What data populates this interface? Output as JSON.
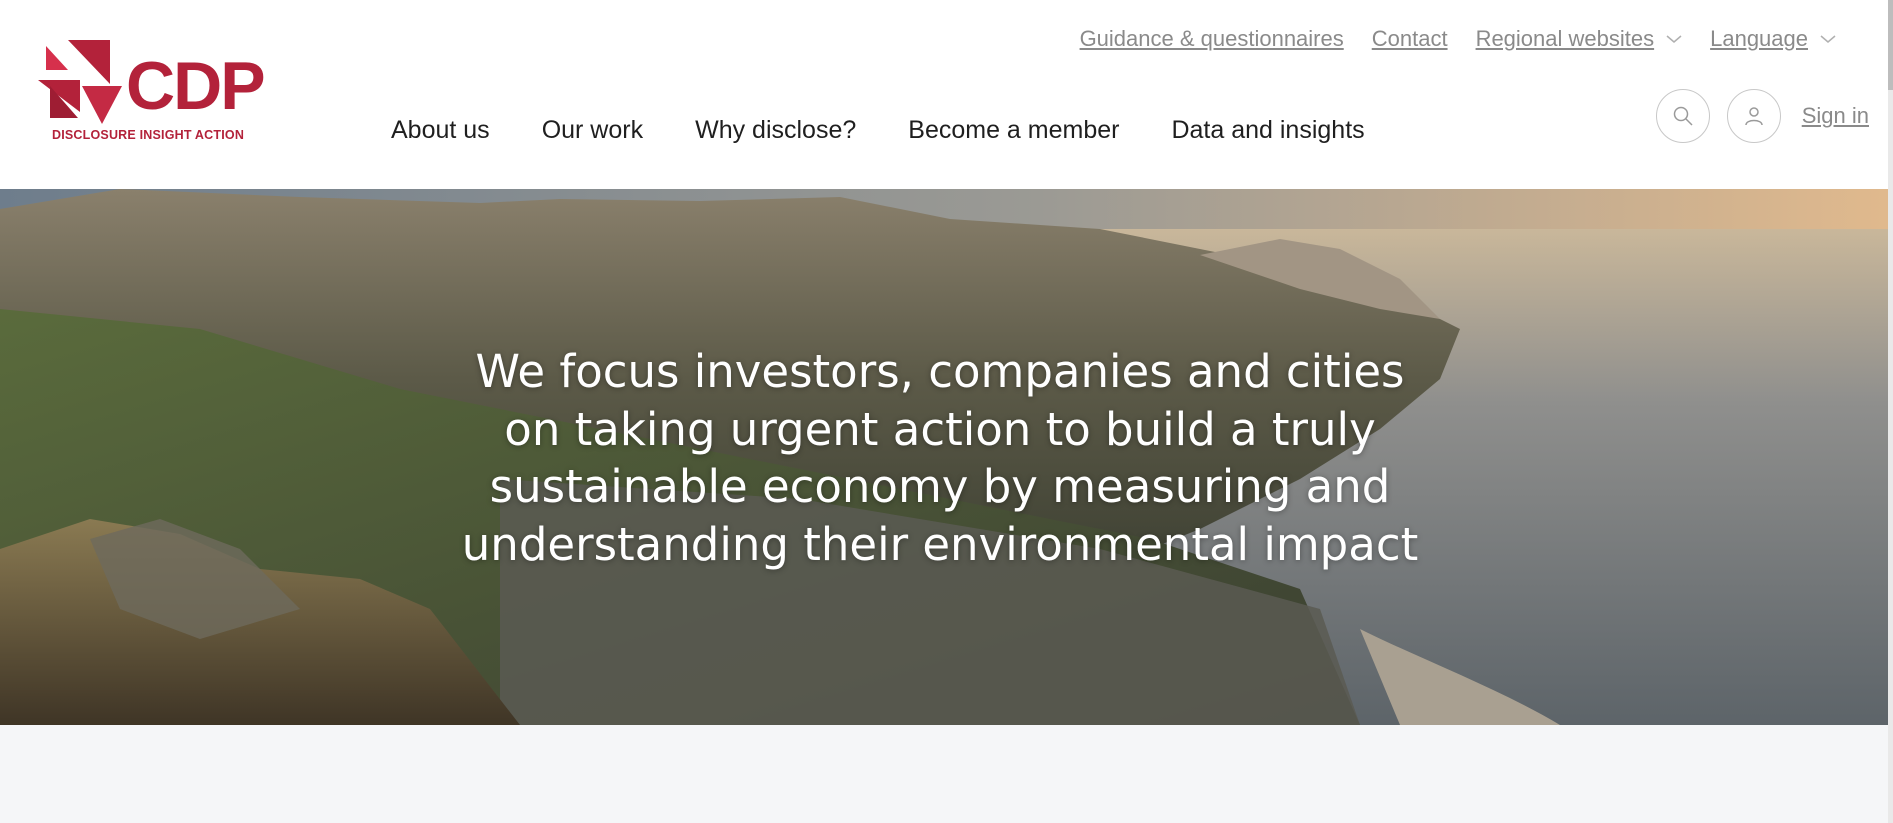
{
  "brand": {
    "name": "CDP",
    "tagline": "DISCLOSURE INSIGHT ACTION",
    "color": "#b3223a"
  },
  "utility_nav": {
    "guidance": "Guidance & questionnaires",
    "contact": "Contact",
    "regional": "Regional websites",
    "language": "Language"
  },
  "main_nav": {
    "about": "About us",
    "work": "Our work",
    "why": "Why disclose?",
    "member": "Become a member",
    "data": "Data and insights"
  },
  "actions": {
    "search_icon": "search-icon",
    "user_icon": "user-icon",
    "signin": "Sign in"
  },
  "hero": {
    "line1": "We focus investors, companies and cities",
    "line2": "on taking urgent action to build a truly",
    "line3": "sustainable economy by measuring and",
    "line4": "understanding their environmental impact"
  },
  "colors": {
    "link_gray": "#8a8a8a",
    "nav_text": "#1f1f1f",
    "page_bg": "#f5f6f8"
  }
}
